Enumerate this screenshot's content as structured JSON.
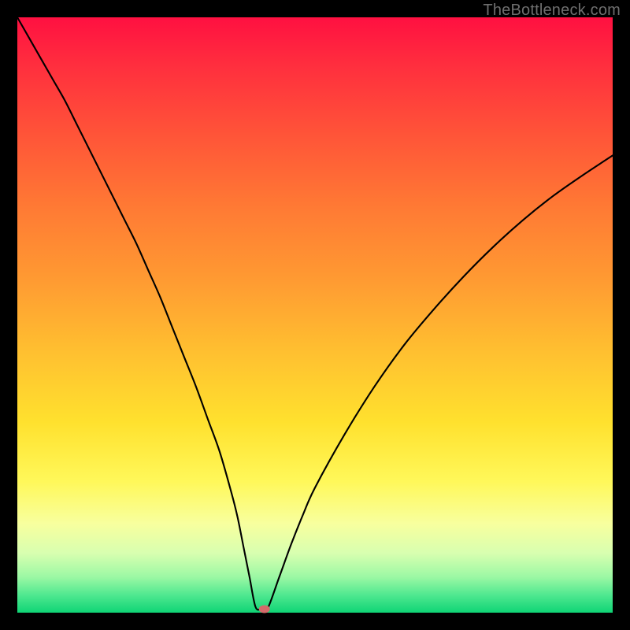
{
  "watermark": "TheBottleneck.com",
  "chart_data": {
    "type": "line",
    "title": "",
    "xlabel": "",
    "ylabel": "",
    "xlim": [
      0,
      100
    ],
    "ylim": [
      0,
      100
    ],
    "grid": false,
    "legend": false,
    "x": [
      0,
      2,
      4,
      6,
      8,
      10,
      12,
      14,
      16,
      18,
      20,
      22,
      24,
      26,
      28,
      30,
      32,
      34,
      36,
      37,
      38,
      39,
      40,
      41,
      42,
      44,
      46,
      48,
      50,
      55,
      60,
      65,
      70,
      75,
      80,
      85,
      90,
      95,
      100
    ],
    "values": [
      100,
      96.5,
      93,
      89.5,
      86,
      82,
      78,
      74,
      70,
      66,
      62,
      57.5,
      53,
      48,
      43,
      38,
      32.5,
      27,
      20,
      16,
      11,
      6,
      1,
      0.6,
      0.6,
      6,
      11.5,
      16.5,
      21,
      30,
      38,
      45,
      51,
      56.5,
      61.5,
      66,
      70,
      73.5,
      76.8
    ],
    "marker": {
      "x": 41.5,
      "y": 0.6,
      "color": "#d46a6a",
      "rx": 7,
      "ry": 5
    },
    "background": "rainbow-vertical"
  }
}
